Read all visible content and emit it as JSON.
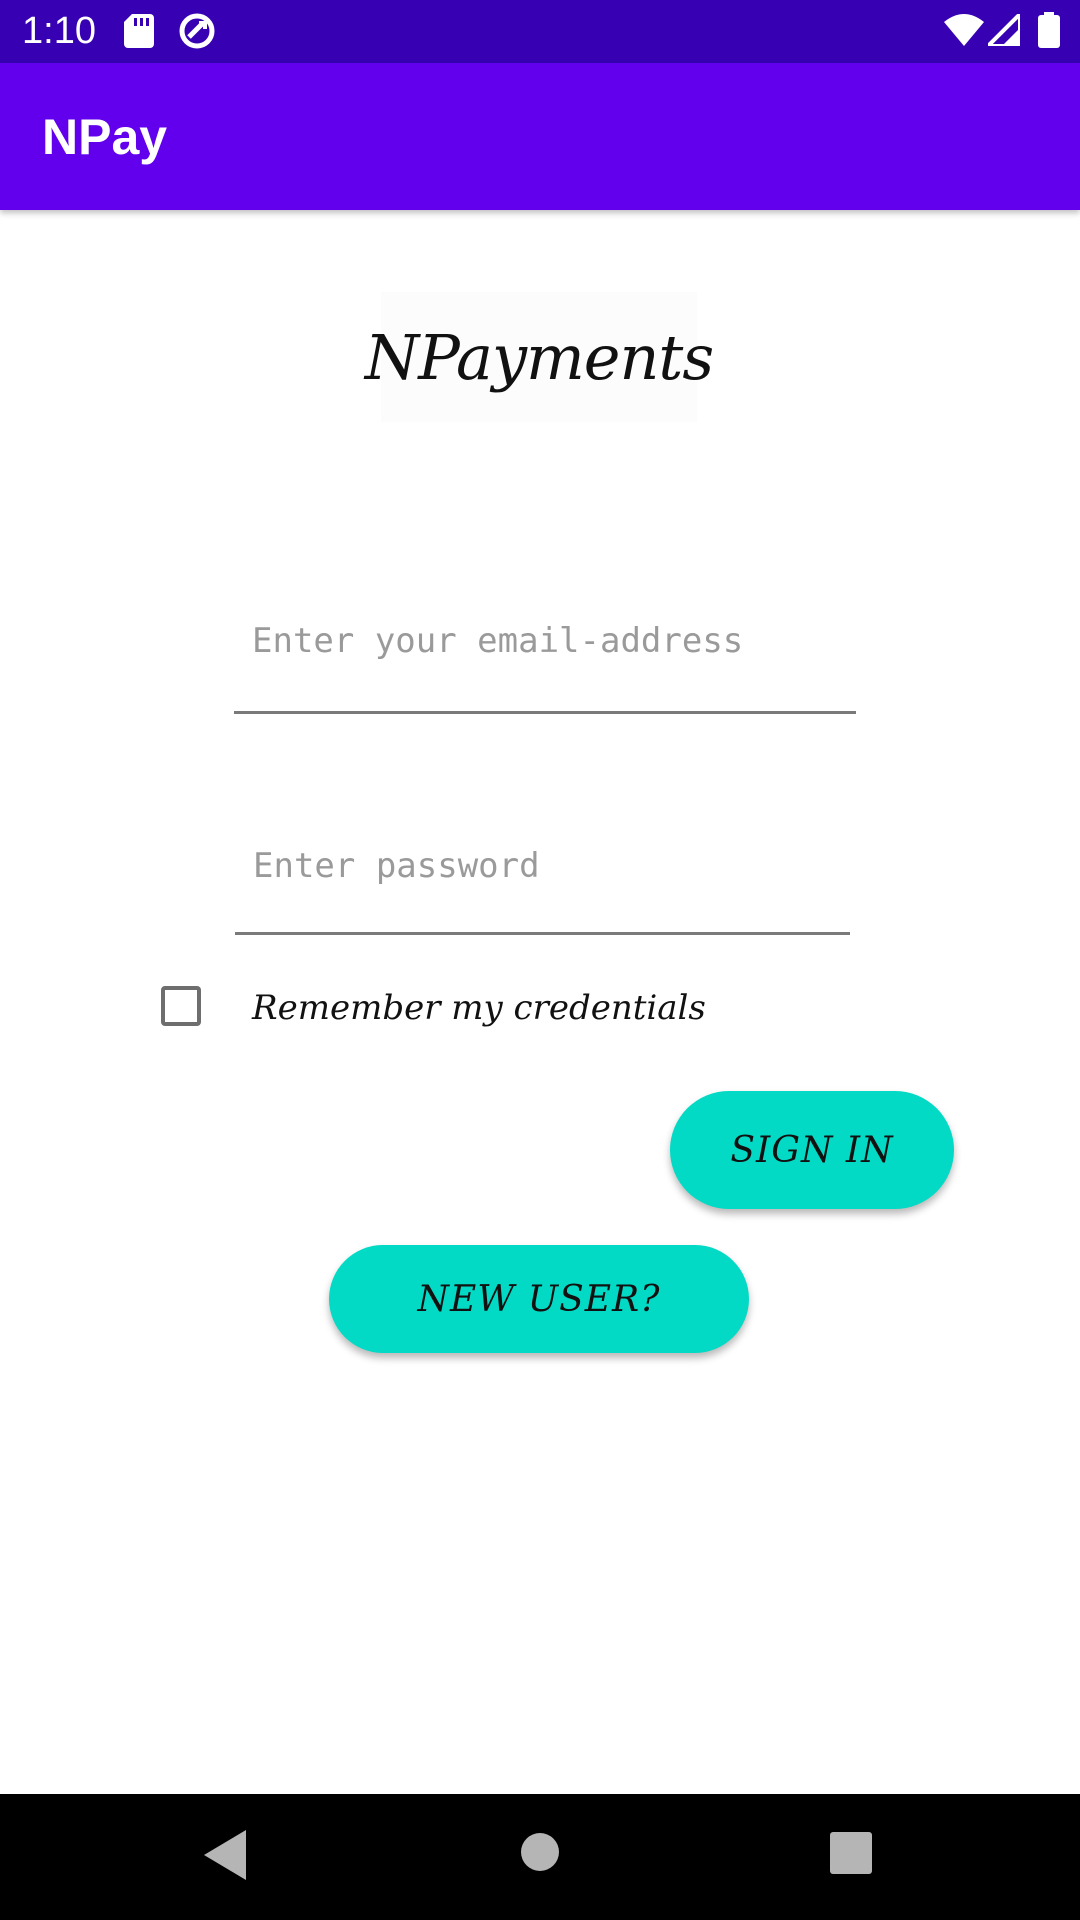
{
  "status_bar": {
    "time": "1:10",
    "left_icons": [
      "sd-card-icon",
      "sync-circle-icon"
    ],
    "right_icons": [
      "wifi-icon",
      "cell-signal-icon",
      "battery-icon"
    ]
  },
  "app_bar": {
    "title": "NPay"
  },
  "logo": {
    "text": "NPayments"
  },
  "form": {
    "email_placeholder": "Enter your email-address",
    "email_value": "",
    "password_placeholder": "Enter password",
    "password_value": "",
    "remember_label": "Remember my credentials",
    "remember_checked": false
  },
  "buttons": {
    "sign_in": "SIGN IN",
    "new_user": "NEW USER?"
  },
  "nav": {
    "back": "back-icon",
    "home": "home-icon",
    "recents": "recents-icon"
  },
  "colors": {
    "status_bar": "#3700b3",
    "app_bar": "#6200ee",
    "accent": "#03dac5"
  }
}
